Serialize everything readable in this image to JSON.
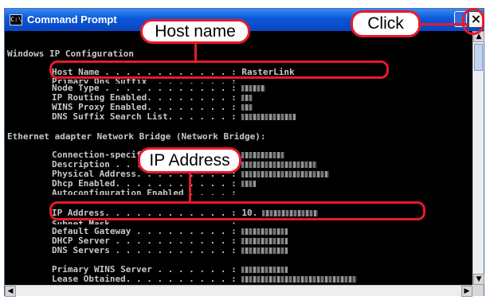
{
  "window": {
    "title": "Command Prompt",
    "icon_glyph": "C:\\",
    "close_glyph": "×"
  },
  "console_lines": [
    "Windows IP Configuration",
    "Host Name . . . . . . . . . . . . : RasterLink",
    "Primary Dns Suffix  . . . . . . . :",
    "Node Type . . . . . . . . . . . . :",
    "IP Routing Enabled. . . . . . . . :",
    "WINS Proxy Enabled. . . . . . . . :",
    "DNS Suffix Search List. . . . . . :",
    "Ethernet adapter Network Bridge (Network Bridge):",
    "Connection-specific DNS Suffix  . :",
    "Description . . . . . . . . . . . :",
    "Physical Address. . . . . . . . . :",
    "Dhcp Enabled. . . . . . . . . . . :",
    "Autoconfiguration Enabled . . . . :",
    "IP Address. . . . . . . . . . . . : 10.",
    "Subnet Mask . . . . . . . . . . . :",
    "Default Gateway . . . . . . . . . :",
    "DHCP Server . . . . . . . . . . . :",
    "DNS Servers . . . . . . . . . . . :",
    "Primary WINS Server . . . . . . . :",
    "Lease Obtained. . . . . . . . . . :"
  ],
  "callouts": {
    "host_name": "Host name",
    "ip_address": "IP Address",
    "click": "Click"
  },
  "colors": {
    "accent_red": "#e8192c",
    "titlebar_blue": "#0a56d8",
    "console_bg": "#000000",
    "console_text": "#c8c8c8"
  },
  "icons": [
    "command-prompt-icon",
    "maximize-icon",
    "close-icon",
    "scroll-up-arrow-icon",
    "scroll-down-arrow-icon",
    "scroll-left-arrow-icon",
    "scroll-right-arrow-icon"
  ]
}
